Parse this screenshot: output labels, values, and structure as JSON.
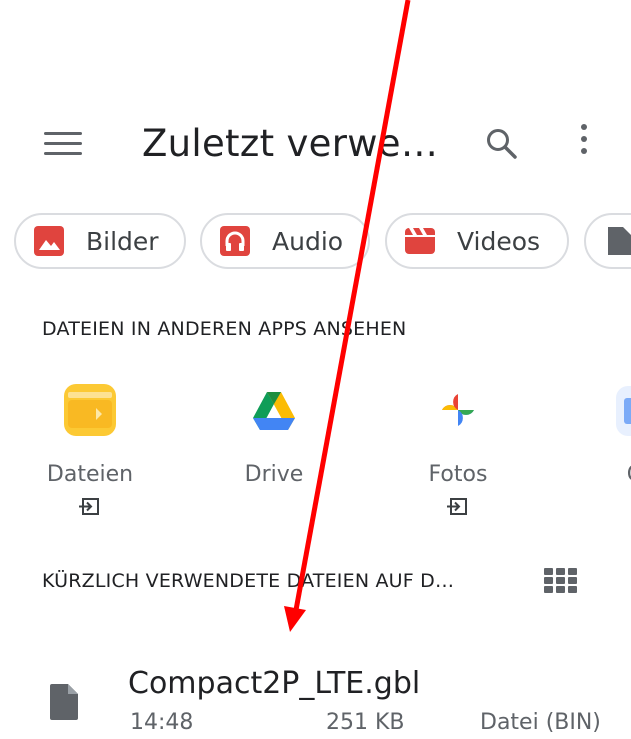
{
  "header": {
    "title": "Zuletzt verwe…",
    "menu_icon": "hamburger-menu-icon",
    "search_icon": "search-icon",
    "more_icon": "more-vert-icon"
  },
  "chips": [
    {
      "label": "Bilder",
      "icon": "image-icon",
      "color": "#e0443e"
    },
    {
      "label": "Audio",
      "icon": "headphones-icon",
      "color": "#e0443e"
    },
    {
      "label": "Videos",
      "icon": "movie-icon",
      "color": "#e0443e"
    },
    {
      "label": "",
      "icon": "document-icon",
      "color": "#5f6368"
    }
  ],
  "apps_section": {
    "title": "DATEIEN IN ANDEREN APPS ANSEHEN",
    "apps": [
      {
        "label": "Dateien",
        "icon": "dateien-app-icon",
        "has_open_icon": true
      },
      {
        "label": "Drive",
        "icon": "google-drive-icon",
        "has_open_icon": false
      },
      {
        "label": "Fotos",
        "icon": "google-photos-icon",
        "has_open_icon": true
      },
      {
        "label": "Ga",
        "icon": "gallery-app-icon",
        "has_open_icon": false
      }
    ]
  },
  "recent_section": {
    "title": "KÜRZLICH VERWENDETE DATEIEN AUF D…",
    "view_toggle_icon": "grid-view-icon"
  },
  "files": [
    {
      "name": "Compact2P_LTE.gbl",
      "time": "14:48",
      "size": "251 KB",
      "type": "Datei (BIN)",
      "icon": "file-icon"
    }
  ],
  "annotation": {
    "color": "#ff0000",
    "shape": "arrow-pointing-down"
  }
}
